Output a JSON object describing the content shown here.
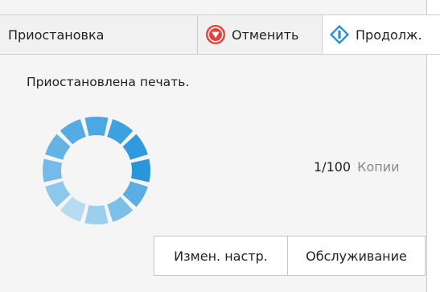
{
  "header": {
    "status_label": "Приостановка",
    "cancel_label": "Отменить",
    "resume_label": "Продолж."
  },
  "main": {
    "status_message": "Приостановлена печать.",
    "copies_count": "1/100",
    "copies_label": "Копии"
  },
  "footer": {
    "change_settings_label": "Измен. настр.",
    "maintenance_label": "Обслуживание"
  },
  "icons": {
    "cancel": "stop-icon",
    "resume": "resume-icon",
    "spinner": "progress-spinner"
  },
  "colors": {
    "cancel_red": "#e8413a",
    "resume_blue": "#1f8fdd",
    "spinner_blue": "#2a9be0"
  }
}
